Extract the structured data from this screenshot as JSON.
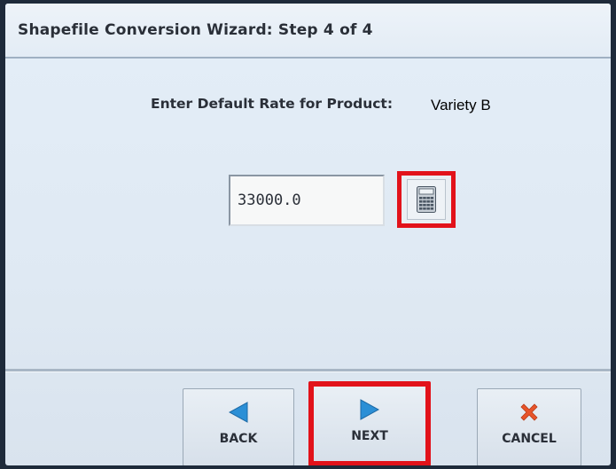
{
  "window": {
    "title": "Shapefile Conversion Wizard:  Step 4 of 4"
  },
  "prompt": {
    "label": "Enter Default Rate for Product:",
    "product": "Variety B"
  },
  "rate_field": {
    "value": "33000.0"
  },
  "calculator": {
    "icon": "calculator-icon"
  },
  "buttons": {
    "back": {
      "label": "BACK",
      "icon": "left-arrow-icon",
      "color": "#2b8fd6"
    },
    "next": {
      "label": "NEXT",
      "icon": "right-arrow-icon",
      "color": "#2b8fd6"
    },
    "cancel": {
      "label": "CANCEL",
      "icon": "x-icon",
      "color": "#e8542a"
    }
  },
  "highlight_color": "#e2121a"
}
